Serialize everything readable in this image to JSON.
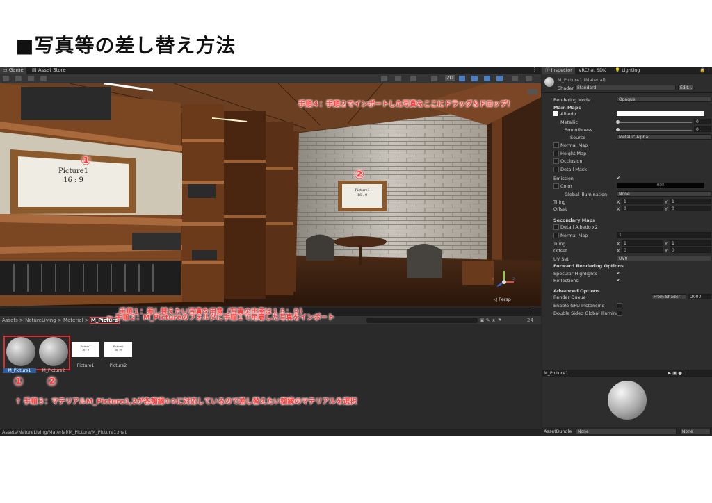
{
  "heading": "■写真等の差し替え方法",
  "tabs": {
    "game": "Game",
    "asset_store": "Asset Store",
    "inspector": "Inspector",
    "vrchat_sdk": "VRChat SDK",
    "lighting": "Lighting"
  },
  "toolbar": {
    "mode_2d": "2D"
  },
  "scene": {
    "frame_left": {
      "name": "Picture1",
      "ratio": "16 : 9"
    },
    "frame_right": {
      "name": "Picture1",
      "ratio": "16 : 9"
    },
    "persp": "◁ Persp",
    "gizmo": {
      "x": "x",
      "z": "z"
    }
  },
  "annotations": {
    "step4": "手順４：手順２でインポートした写真をここにドラッグ＆ドロップ！",
    "circle1": "①",
    "circle2": "②",
    "step1": "手順１：差し替えたい写真を用意（写真の比率は１６：９）",
    "step2": "← 手順２：M_Pictureのフォルダに手順１で用意した写真をインポート",
    "step3": "↑ 手順３：マテリアルM_Picture1,2が各額縁①②に対応しているので差し替えたい額縁のマテリアルを選択"
  },
  "project": {
    "breadcrumb": [
      "Assets",
      "NatureLiving",
      "Material",
      "M_Picture"
    ],
    "sep": ">",
    "count": "24",
    "items": [
      {
        "label": "M_Picture1",
        "selected": true
      },
      {
        "label": "M_Picture2",
        "selected": false
      },
      {
        "label": "Picture1",
        "thumb_text": "Picture1",
        "thumb_ratio": "16 : 9"
      },
      {
        "label": "Picture2",
        "thumb_text": "Picture2",
        "thumb_ratio": "16 : 9"
      }
    ],
    "path": "Assets/NatureLiving/Material/M_Picture/M_Picture1.mat"
  },
  "inspector": {
    "material_name": "M_Picture1 (Material)",
    "shader_label": "Shader",
    "shader_value": "Standard",
    "edit_button": "Edit...",
    "rendering_mode_label": "Rendering Mode",
    "rendering_mode_value": "Opaque",
    "main_maps": "Main Maps",
    "albedo": "Albedo",
    "metallic": "Metallic",
    "metallic_value": "0",
    "smoothness": "Smoothness",
    "smoothness_value": "0",
    "source": "Source",
    "source_value": "Metallic Alpha",
    "normal_map": "Normal Map",
    "height_map": "Height Map",
    "occlusion": "Occlusion",
    "detail_mask": "Detail Mask",
    "emission": "Emission",
    "color": "Color",
    "hdr": "HDR",
    "global_illumination": "Global Illumination",
    "gi_value": "None",
    "tiling": "Tiling",
    "offset": "Offset",
    "x": "X",
    "y": "Y",
    "tiling_x": "1",
    "tiling_y": "1",
    "offset_x": "0",
    "offset_y": "0",
    "secondary_maps": "Secondary Maps",
    "detail_albedo": "Detail Albedo x2",
    "normal_map2": "Normal Map",
    "normal_map2_value": "1",
    "tiling2_x": "1",
    "tiling2_y": "1",
    "offset2_x": "0",
    "offset2_y": "0",
    "uv_set": "UV Set",
    "uv_set_value": "UV0",
    "forward_rendering": "Forward Rendering Options",
    "specular_highlights": "Specular Highlights",
    "reflections": "Reflections",
    "advanced": "Advanced Options",
    "render_queue": "Render Queue",
    "render_queue_mode": "From Shader",
    "render_queue_value": "2000",
    "gpu_instancing": "Enable GPU Instancing",
    "double_sided": "Double Sided Global Illuminat",
    "preview_name": "M_Picture1",
    "asset_bundle": "AssetBundle",
    "asset_bundle_value": "None",
    "asset_bundle_variant": "None"
  }
}
